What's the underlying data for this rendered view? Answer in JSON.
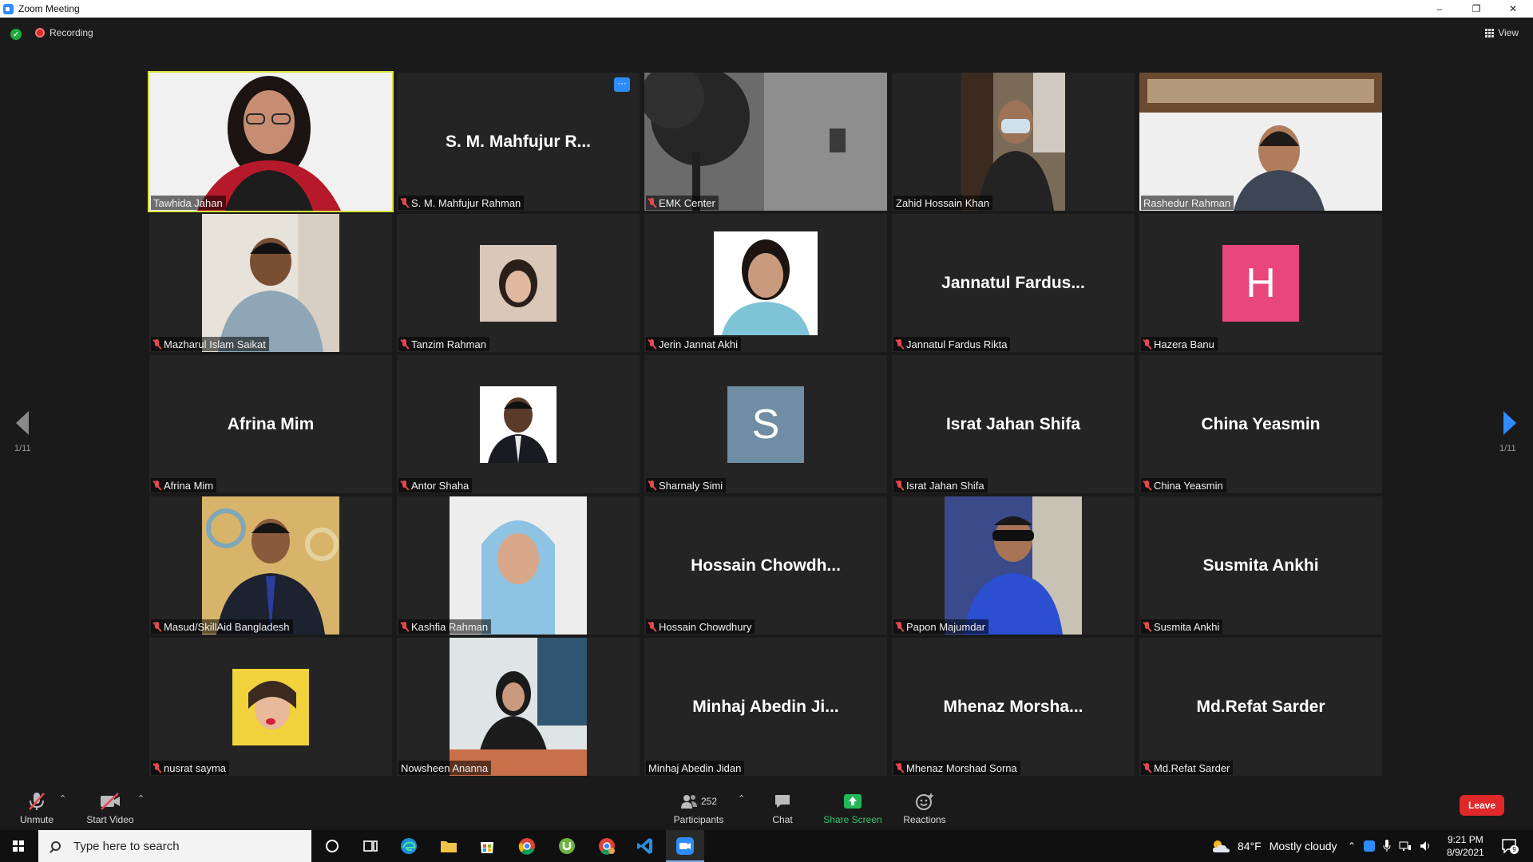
{
  "window": {
    "title": "Zoom Meeting",
    "controls": {
      "minimize": "–",
      "restore": "❐",
      "close": "✕"
    }
  },
  "topbar": {
    "recording_label": "Recording",
    "view_label": "View"
  },
  "colors": {
    "accent_blue": "#2d8cff",
    "active_speaker": "#d7e33c",
    "leave_red": "#e02828",
    "muted_red": "#e5484d"
  },
  "pager": {
    "left": "1/11",
    "right": "1/11"
  },
  "participants": [
    {
      "name": "Tawhida Jahan",
      "muted": false,
      "video": "photo",
      "active": true
    },
    {
      "name": "S. M. Mahfujur Rahman",
      "display": "S. M. Mahfujur R...",
      "muted": true,
      "video": "none",
      "more_button": "···"
    },
    {
      "name": "EMK Center",
      "muted": true,
      "video": "photo"
    },
    {
      "name": "Zahid Hossain Khan",
      "muted": false,
      "video": "photo"
    },
    {
      "name": "Rashedur Rahman",
      "muted": false,
      "video": "photo"
    },
    {
      "name": "Mazharul Islam Saikat",
      "muted": true,
      "video": "photo"
    },
    {
      "name": "Tanzim Rahman",
      "muted": true,
      "video": "avatar"
    },
    {
      "name": "Jerin Jannat Akhi",
      "muted": true,
      "video": "avatar"
    },
    {
      "name": "Jannatul Fardus Rikta",
      "display": "Jannatul Fardus...",
      "muted": true,
      "video": "none"
    },
    {
      "name": "Hazera Banu",
      "muted": true,
      "video": "letter",
      "letter": "H",
      "letter_color": "#e8467c"
    },
    {
      "name": "Afrina Mim",
      "display": "Afrina Mim",
      "muted": true,
      "video": "none"
    },
    {
      "name": "Antor Shaha",
      "muted": true,
      "video": "avatar"
    },
    {
      "name": "Sharnaly Simi",
      "muted": true,
      "video": "letter",
      "letter": "S",
      "letter_color": "#6f8ea3"
    },
    {
      "name": "Israt Jahan Shifa",
      "display": "Israt Jahan Shifa",
      "muted": true,
      "video": "none"
    },
    {
      "name": "China Yeasmin",
      "display": "China Yeasmin",
      "muted": true,
      "video": "none"
    },
    {
      "name": "Masud/SkillAid Bangladesh",
      "muted": true,
      "video": "photo"
    },
    {
      "name": "Kashfia Rahman",
      "muted": true,
      "video": "photo"
    },
    {
      "name": "Hossain Chowdhury",
      "display": "Hossain Chowdh...",
      "muted": true,
      "video": "none"
    },
    {
      "name": "Papon Majumdar",
      "muted": true,
      "video": "photo"
    },
    {
      "name": "Susmita Ankhi",
      "display": "Susmita Ankhi",
      "muted": true,
      "video": "none"
    },
    {
      "name": "nusrat sayma",
      "muted": true,
      "video": "avatar"
    },
    {
      "name": "Nowsheen Ananna",
      "muted": false,
      "video": "photo"
    },
    {
      "name": "Minhaj Abedin Jidan",
      "display": "Minhaj Abedin Ji...",
      "muted": false,
      "video": "none"
    },
    {
      "name": "Mhenaz Morshad Sorna",
      "display": "Mhenaz Morsha...",
      "muted": true,
      "video": "none"
    },
    {
      "name": "Md.Refat Sarder",
      "display": "Md.Refat Sarder",
      "muted": true,
      "video": "none"
    }
  ],
  "toolbar": {
    "unmute": "Unmute",
    "start_video": "Start Video",
    "participants_count": "252",
    "participants": "Participants",
    "chat": "Chat",
    "share_screen": "Share Screen",
    "reactions": "Reactions",
    "leave": "Leave"
  },
  "taskbar": {
    "search_placeholder": "Type here to search",
    "weather_temp": "84°F",
    "weather_desc": "Mostly cloudy",
    "time": "9:21 PM",
    "date": "8/9/2021",
    "notifications": "9"
  }
}
